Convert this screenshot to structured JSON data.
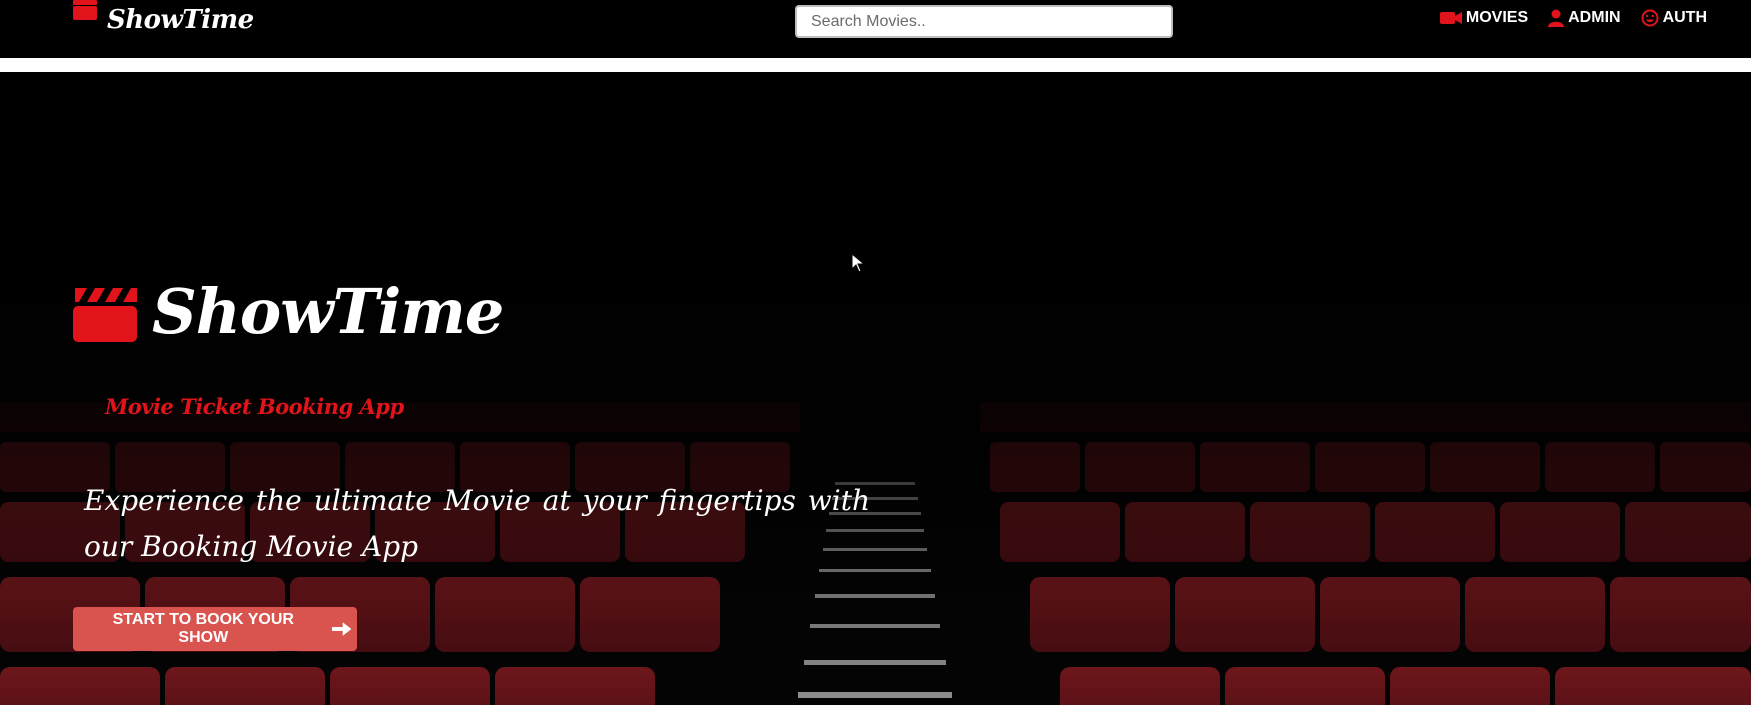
{
  "navbar": {
    "brand": "ShowTime",
    "search_placeholder": "Search Movies..",
    "links": [
      {
        "label": "MOVIES",
        "icon": "video-camera-icon"
      },
      {
        "label": "ADMIN",
        "icon": "user-icon"
      },
      {
        "label": "AUTH",
        "icon": "smiley-icon"
      }
    ]
  },
  "hero": {
    "title": "ShowTime",
    "subtitle": "Movie Ticket Booking App",
    "tagline": "Experience the ultimate Movie at your fingertips with our Booking Movie App",
    "cta_label": "START TO BOOK YOUR SHOW",
    "cta_icon": "arrow-right-icon"
  },
  "colors": {
    "accent_red": "#e0141a",
    "button_red": "#d9534f",
    "seat_red": "#7a1a1f",
    "background": "#000000"
  }
}
